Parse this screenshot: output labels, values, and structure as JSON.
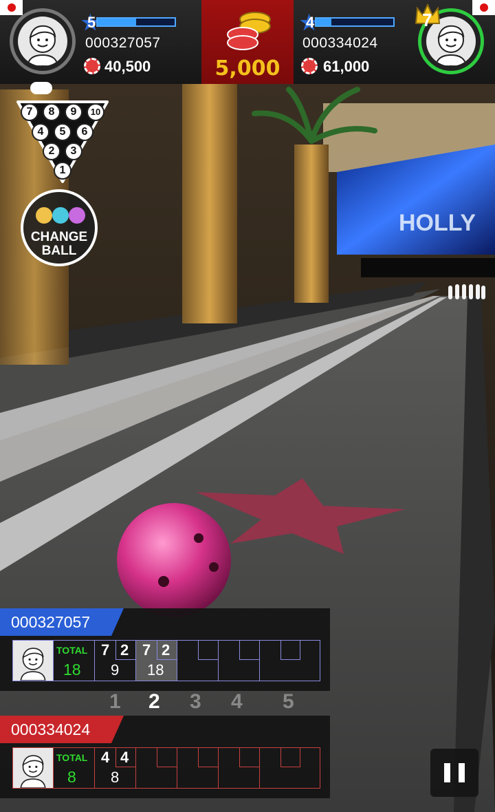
{
  "pot": {
    "value": "5,000"
  },
  "player1": {
    "level": "5",
    "level_fill": 0.5,
    "id": "000327057",
    "chips": "40,500"
  },
  "player2": {
    "level": "7",
    "id": "000334024",
    "chips": "61,000",
    "level_badge": "4",
    "level_fill": 0.2
  },
  "pin_rack": [
    "7",
    "8",
    "9",
    "10",
    "4",
    "5",
    "6",
    "2",
    "3",
    "1"
  ],
  "change_ball": {
    "line1": "CHANGE",
    "line2": "BALL"
  },
  "scoreboard": {
    "p1": {
      "id": "000327057",
      "total_label": "TOTAL",
      "total": "18",
      "f1": {
        "r1": "7",
        "r2": "2",
        "cum": "9"
      },
      "f2": {
        "r1": "7",
        "r2": "2",
        "cum": "18"
      }
    },
    "p2": {
      "id": "000334024",
      "total_label": "TOTAL",
      "total": "8",
      "f1": {
        "r1": "4",
        "r2": "4",
        "cum": "8"
      }
    },
    "frames": [
      "1",
      "2",
      "3",
      "4",
      "5"
    ],
    "current_frame": "2"
  },
  "colors": {
    "p1_tag": "#2a5fd6",
    "p2_tag": "#c8262b",
    "pot_bg": "#8a0c0c",
    "gold": "#f4c21c",
    "ball": "#d6338a"
  },
  "icons": [
    "pause-icon",
    "chips-icon",
    "avatar-icon",
    "crown-icon",
    "star-icon",
    "flag-japan-icon"
  ]
}
